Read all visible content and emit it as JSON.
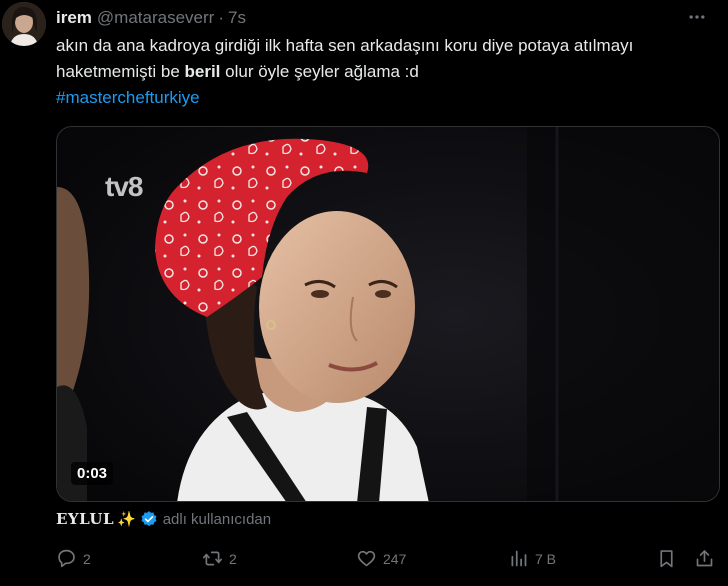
{
  "tweet": {
    "display_name": "irem",
    "handle": "@mataraseverr",
    "separator": "·",
    "time": "7s",
    "text_part1": "akın da ana kadroya girdiği ilk hafta sen arkadaşını koru diye potaya atılmayı haketmemişti be ",
    "text_bold": "beril",
    "text_part2": " olur öyle şeyler ağlama :d",
    "hashtag": "#masterchefturkiye"
  },
  "media": {
    "type": "video",
    "logo_text": "tv8",
    "duration": "0:03"
  },
  "attribution": {
    "name": "EYLUL",
    "emoji": "✨",
    "verified": true,
    "from_text": "adlı kullanıcıdan"
  },
  "actions": {
    "reply_count": "2",
    "retweet_count": "2",
    "like_count": "247",
    "views_count": "7 B"
  },
  "colors": {
    "background": "#000000",
    "text": "#e7e9ea",
    "muted": "#71767b",
    "accent": "#1d9bf0",
    "bandana": "#d4232e"
  },
  "icons": {
    "more": "more-horizontal-icon",
    "reply": "reply-icon",
    "retweet": "retweet-icon",
    "like": "heart-icon",
    "views": "views-chart-icon",
    "bookmark": "bookmark-icon",
    "share": "share-icon",
    "verified": "verified-badge-icon"
  }
}
